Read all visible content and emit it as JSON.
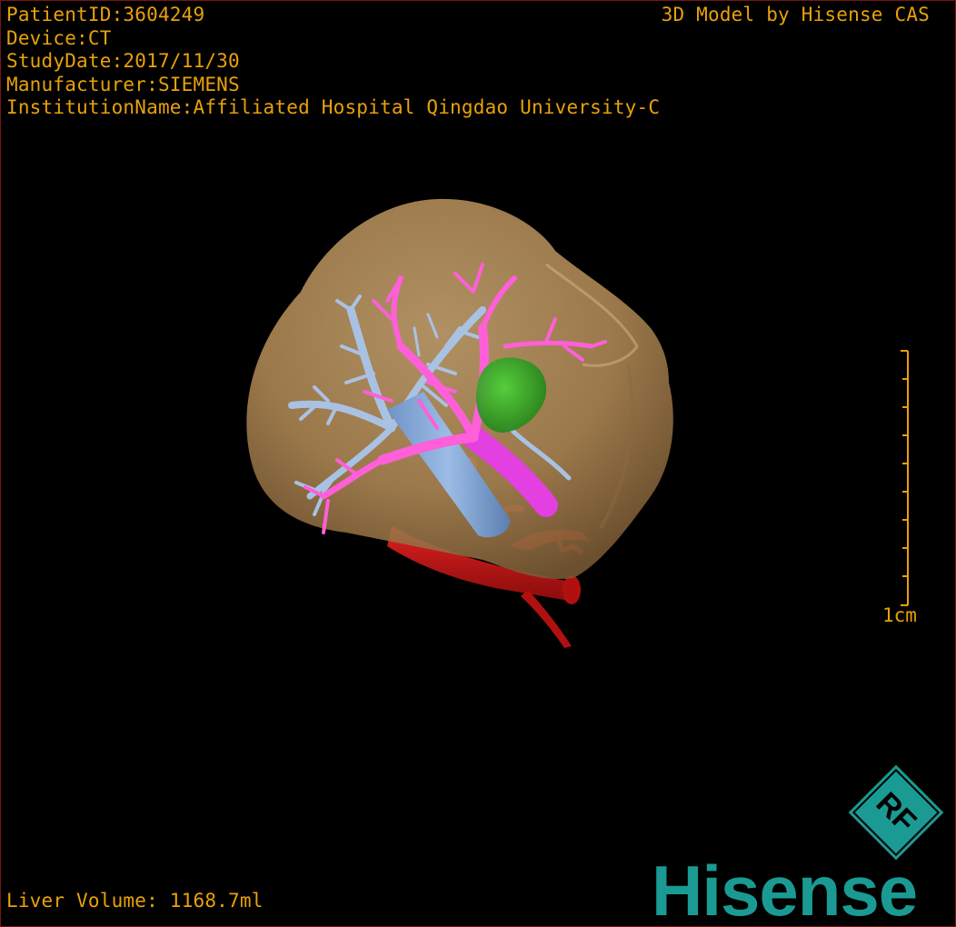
{
  "study_info": {
    "patient_id": "PatientID:3604249",
    "device": "Device:CT",
    "study_date": "StudyDate:2017/11/30",
    "manufacturer": "Manufacturer:SIEMENS",
    "institution": "InstitutionName:Affiliated Hospital Qingdao University-C"
  },
  "model_credit": "3D Model by Hisense CAS",
  "liver_volume": "Liver Volume: 1168.7ml",
  "scale": {
    "label": "1cm",
    "ticks": 10
  },
  "branding": {
    "logo_text": "Hisense",
    "badge_letters": "RF"
  },
  "colors": {
    "overlay_text": "#e8a10b",
    "liver": "#b8925c",
    "portal_vein": "#ff5fd8",
    "hepatic_vein": "#a9c2e4",
    "artery": "#c41414",
    "lesion": "#2fae22",
    "brand": "#1a9a93",
    "border": "#7a1414"
  },
  "icons": [
    "rf-badge-icon",
    "hisense-logo"
  ]
}
